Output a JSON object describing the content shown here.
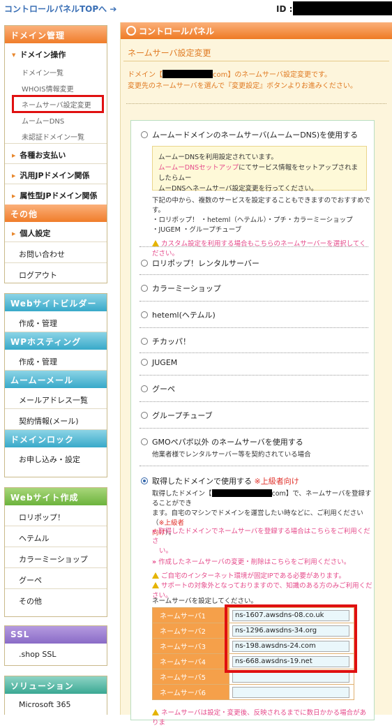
{
  "top": {
    "link": "コントロールパネルTOPへ ➔",
    "id_label": "ID :"
  },
  "sidebar": {
    "domain_head": "ドメイン管理",
    "domain_ops": "ドメイン操作",
    "sub": [
      "ドメイン一覧",
      "WHOIS情報変更",
      "ネームサーバ設定変更",
      "ムームーDNS",
      "未認証ドメイン一覧"
    ],
    "bold_items": [
      "各種お支払い",
      "汎用JPドメイン関係",
      "属性型JPドメイン関係"
    ],
    "other_head": "その他",
    "other_items": [
      "個人設定",
      "お問い合わせ",
      "ログアウト"
    ],
    "builder_head": "Webサイトビルダー",
    "builder_item": "作成・管理",
    "wp_head": "WPホスティング",
    "wp_item": "作成・管理",
    "mail_head": "ムームーメール",
    "mail_items": [
      "メールアドレス一覧",
      "契約情報(メール)"
    ],
    "lock_head": "ドメインロック",
    "lock_item": "お申し込み・設定",
    "web_head": "Webサイト作成",
    "web_items": [
      "ロリポップ！",
      "ヘテムル",
      "カラーミーショップ",
      "グーペ",
      "その他"
    ],
    "ssl_head": "SSL",
    "ssl_item": ".shop SSL",
    "sol_head": "ソリューション",
    "sol_item": "Microsoft 365"
  },
  "main": {
    "title": "コントロールパネル",
    "subtitle": "ネームサーバ設定変更",
    "intro1a": "ドメイン【",
    "intro1b": "com】のネームサーバ設定変更です。",
    "intro2": "変更先のネームサーバを選んで『変更設定』ボタンよりお進みください。",
    "opt_muumuu": "ムームードメインのネームサーバ(ムームーDNS)を使用する",
    "mbox1": "ムームーDNSを利用設定されています。",
    "mbox2a": "ムームーDNSセットアップ",
    "mbox2b": "にてサービス情報をセットアップされましたらムー",
    "mbox3": "ムーDNSへネームサーバ設定変更を行ってください。",
    "note1": "下記の中から、複数のサービスを設定することもできますのでおすすめです。",
    "note2": "・ロリポップ！ ・heteml（ヘテムル）・プチ・カラーミーショップ",
    "note3": "・JUGEM ・グループチューブ",
    "note4a": "カスタム設定",
    "note4b": "を利用する場合もこちらのネームサーバーを選択してください。",
    "options": [
      "ロリポップ！レンタルサーバー",
      "カラーミーショップ",
      "heteml(ヘテムル)",
      "チカッパ！",
      "JUGEM",
      "グーペ",
      "グループチューブ"
    ],
    "opt_gmo": "GMOペパボ以外 のネームサーバを使用する",
    "opt_gmo_note": "他業者様でレンタルサーバー等を契約されている場合",
    "opt_own": "取得したドメインで使用する",
    "opt_own_tag": "※上級者向け",
    "own1a": "取得したドメイン【",
    "own1b": "com】で、ネームサーバを登録することができ",
    "own2": "ます。自宅のマシンでドメインを運営したい時などに、ご利用ください（",
    "own2tag": "※上級者",
    "own3": "向け",
    "own3b": "）。",
    "link1": "取得したドメインでネームサーバを登録する場合はこちらをご利用くださ",
    "link1b": "い。",
    "link2": "作成したネームサーバの変更・削除はこちらをご利用ください。",
    "warn1": "ご自宅のインターネット環境が固定IPである必要があります。",
    "warn2": "サポートの対象外となっておりますので、知識のある方のみご利用ください。",
    "ns_prompt": "ネームサーバを設定してください。",
    "ns": [
      {
        "label": "ネームサーバ1",
        "value": "ns-1607.awsdns-08.co.uk"
      },
      {
        "label": "ネームサーバ2",
        "value": "ns-1296.awsdns-34.org"
      },
      {
        "label": "ネームサーバ3",
        "value": "ns-198.awsdns-24.com"
      },
      {
        "label": "ネームサーバ4",
        "value": "ns-668.awsdns-19.net"
      },
      {
        "label": "ネームサーバ5",
        "value": ""
      },
      {
        "label": "ネームサーバ6",
        "value": ""
      }
    ],
    "footer_warn": "ネームサーバは設定・変更後、反映されるまでに数日かかる場合がありま"
  }
}
